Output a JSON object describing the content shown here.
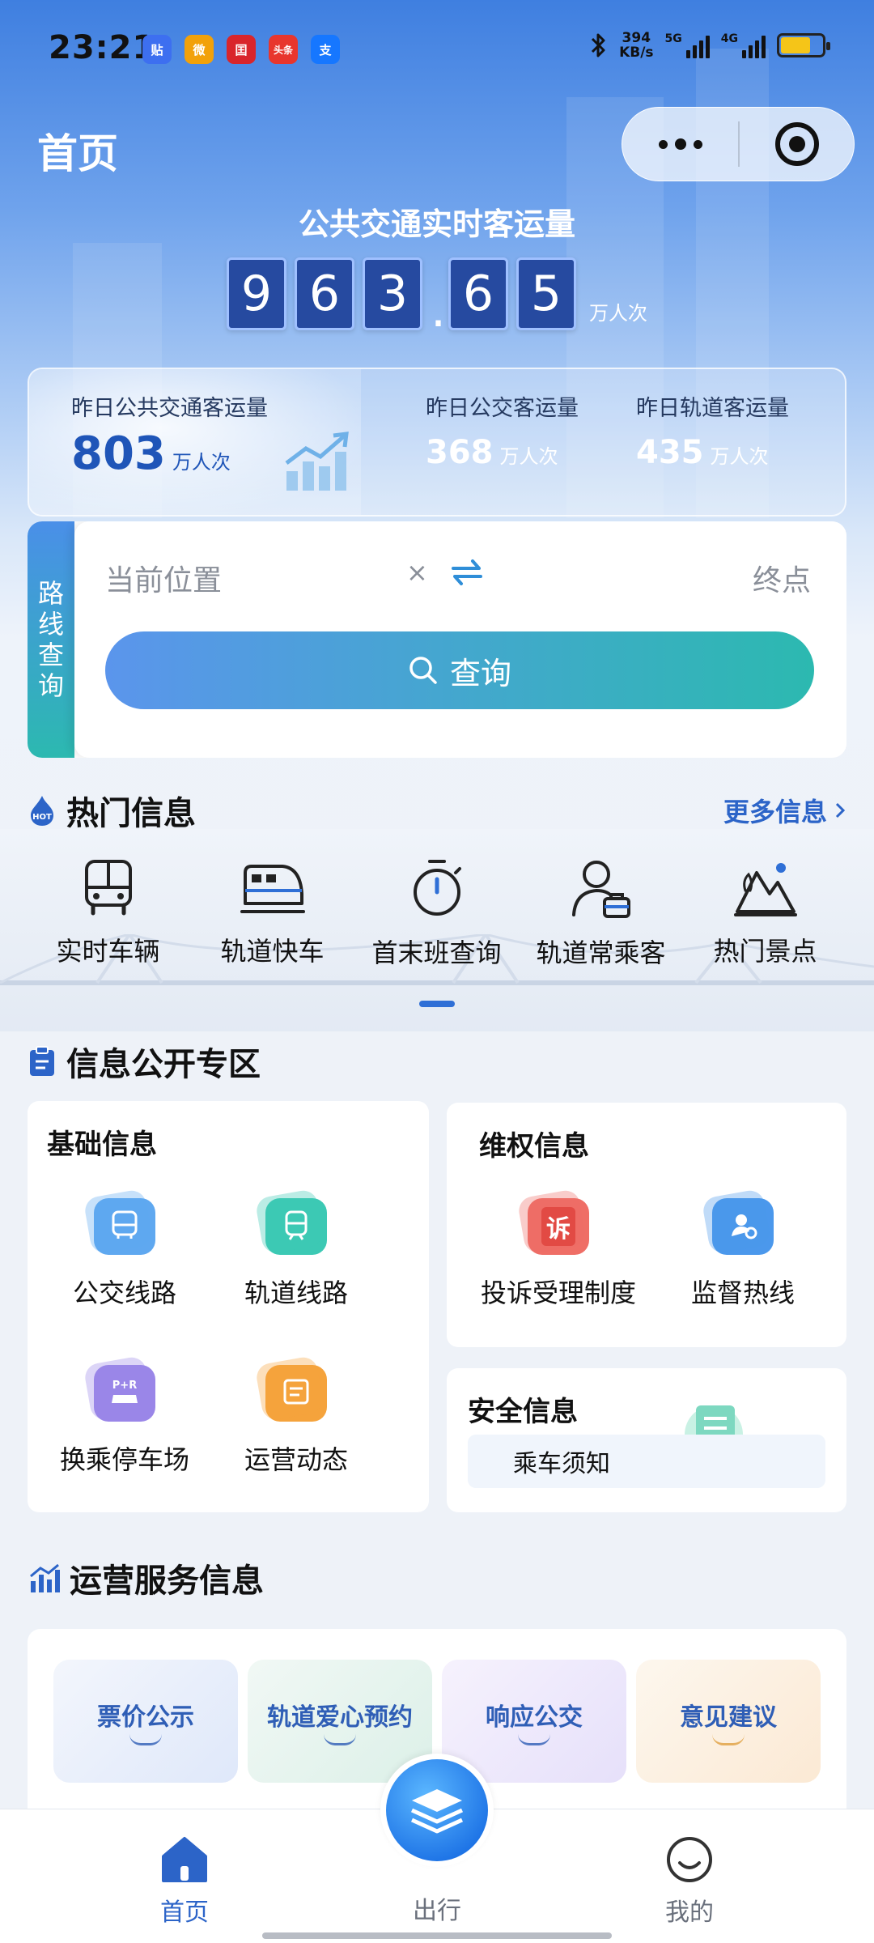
{
  "status_bar": {
    "time": "23:21",
    "apps": [
      {
        "icon": "tieba-icon",
        "glyph": "贴",
        "color": "#3d6ff0"
      },
      {
        "icon": "weibo-icon",
        "glyph": "微",
        "color": "#f2a10a"
      },
      {
        "icon": "cctv-news-icon",
        "glyph": "囯",
        "color": "#d9252b"
      },
      {
        "icon": "toutiao-icon",
        "glyph": "头条",
        "color": "#e8362d"
      },
      {
        "icon": "alipay-icon",
        "glyph": "支",
        "color": "#1677ff"
      }
    ],
    "net_speed_value": "394",
    "net_speed_unit": "KB/s",
    "signal1_label": "5G",
    "signal2_label": "4G",
    "battery_color": "#f5c518"
  },
  "header": {
    "title": "首页"
  },
  "realtime": {
    "title": "公共交通实时客运量",
    "digits_int": [
      "9",
      "6",
      "3"
    ],
    "decimal_point": ".",
    "digits_dec": [
      "6",
      "5"
    ],
    "unit": "万人次"
  },
  "yesterday": {
    "total_label": "昨日公共交通客运量",
    "total_value": "803",
    "total_unit": "万人次",
    "bus_label": "昨日公交客运量",
    "bus_value": "368",
    "bus_unit": "万人次",
    "rail_label": "昨日轨道客运量",
    "rail_value": "435",
    "rail_unit": "万人次"
  },
  "route": {
    "tab_label": [
      "路",
      "线",
      "查",
      "询"
    ],
    "from_placeholder": "当前位置",
    "clear_glyph": "×",
    "to_placeholder": "终点",
    "search_label": "查询"
  },
  "hot": {
    "title": "热门信息",
    "more": "更多信息",
    "items": [
      {
        "label": "实时车辆",
        "icon": "bus-icon"
      },
      {
        "label": "轨道快车",
        "icon": "train-icon"
      },
      {
        "label": "首末班查询",
        "icon": "stopwatch-icon"
      },
      {
        "label": "轨道常乘客",
        "icon": "frequent-rider-icon"
      },
      {
        "label": "热门景点",
        "icon": "scenic-spot-icon"
      }
    ]
  },
  "disclosure": {
    "title": "信息公开专区",
    "basic": {
      "title": "基础信息",
      "items": [
        {
          "label": "公交线路",
          "icon": "bus-route-icon"
        },
        {
          "label": "轨道线路",
          "icon": "rail-route-icon"
        },
        {
          "label": "换乘停车场",
          "icon": "park-and-ride-icon"
        },
        {
          "label": "运营动态",
          "icon": "operation-news-icon"
        }
      ]
    },
    "rights": {
      "title": "维权信息",
      "items": [
        {
          "label": "投诉受理制度",
          "icon": "complaint-icon",
          "glyph": "诉"
        },
        {
          "label": "监督热线",
          "icon": "hotline-icon"
        }
      ]
    },
    "safety": {
      "title": "安全信息",
      "chip": "乘车须知"
    }
  },
  "ops": {
    "title": "运营服务信息",
    "items": [
      {
        "label": "票价公示",
        "bg": "#e9f0fb",
        "color": "#2f5eb6"
      },
      {
        "label": "轨道爱心预约",
        "bg": "#e8f5f1",
        "color": "#2f5eb6"
      },
      {
        "label": "响应公交",
        "bg": "#eeeafb",
        "color": "#2f5eb6"
      },
      {
        "label": "意见建议",
        "bg": "#fdf1e4",
        "color": "#2f5eb6"
      }
    ]
  },
  "bottom_nav": {
    "home": "首页",
    "travel": "出行",
    "mine": "我的"
  },
  "colors": {
    "accent": "#2c64c8",
    "gradient_start": "#5b95ec",
    "gradient_end": "#2cb9b0"
  }
}
